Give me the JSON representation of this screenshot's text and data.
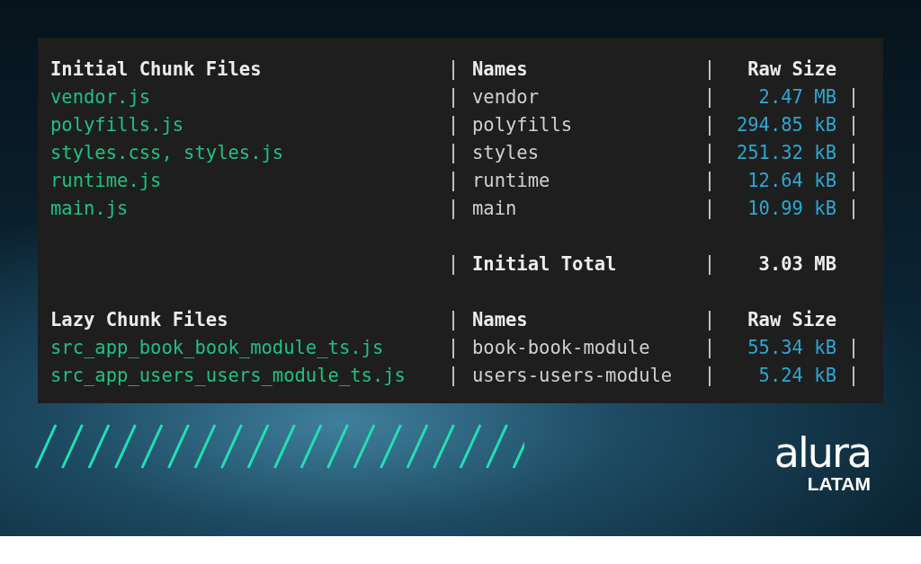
{
  "terminal": {
    "sections": [
      {
        "header": {
          "files": "Initial Chunk Files",
          "names": "Names",
          "size": "Raw Size"
        },
        "rows": [
          {
            "file": "vendor.js",
            "name": "vendor",
            "size": "2.47 MB"
          },
          {
            "file": "polyfills.js",
            "name": "polyfills",
            "size": "294.85 kB"
          },
          {
            "file": "styles.css, styles.js",
            "name": "styles",
            "size": "251.32 kB"
          },
          {
            "file": "runtime.js",
            "name": "runtime",
            "size": "12.64 kB"
          },
          {
            "file": "main.js",
            "name": "main",
            "size": "10.99 kB"
          }
        ],
        "total": {
          "label": "Initial Total",
          "size": "3.03 MB"
        }
      },
      {
        "header": {
          "files": "Lazy Chunk Files",
          "names": "Names",
          "size": "Raw Size"
        },
        "rows": [
          {
            "file": "src_app_book_book_module_ts.js",
            "name": "book-book-module",
            "size": "55.34 kB"
          },
          {
            "file": "src_app_users_users_module_ts.js",
            "name": "users-users-module",
            "size": "5.24 kB"
          }
        ]
      }
    ]
  },
  "logo": {
    "wordmark": "alura",
    "region": "LATAM"
  }
}
